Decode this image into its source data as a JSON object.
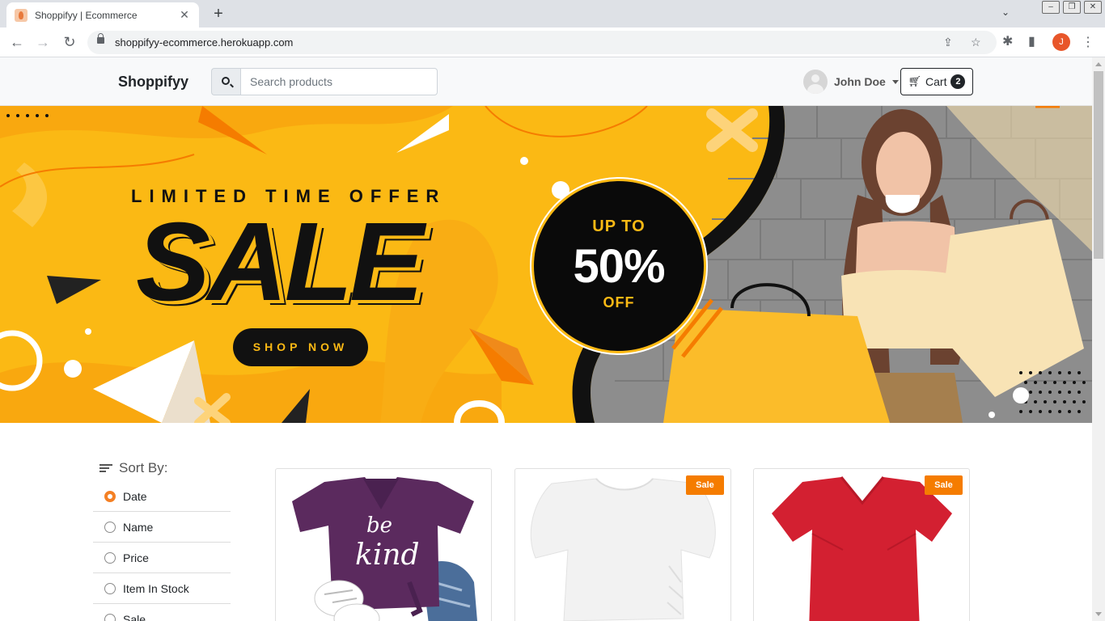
{
  "browser": {
    "tab_title": "Shoppifyy | Ecommerce",
    "url": "shoppifyy-ecommerce.herokuapp.com",
    "profile_initial": "J"
  },
  "header": {
    "brand": "Shoppifyy",
    "search_placeholder": "Search products",
    "user_name": "John Doe",
    "cart_label": "Cart",
    "cart_count": "2"
  },
  "hero": {
    "tagline": "LIMITED TIME OFFER",
    "headline": "SALE",
    "cta": "SHOP NOW",
    "badge_top": "UP TO",
    "badge_value": "50%",
    "badge_bottom": "OFF",
    "colors": {
      "yellow": "#fbb914",
      "orange": "#f57c00",
      "black": "#111111"
    }
  },
  "sort": {
    "title": "Sort By:",
    "options": [
      {
        "label": "Date",
        "selected": true
      },
      {
        "label": "Name",
        "selected": false
      },
      {
        "label": "Price",
        "selected": false
      },
      {
        "label": "Item In Stock",
        "selected": false
      },
      {
        "label": "Sale",
        "selected": false
      }
    ]
  },
  "products": [
    {
      "image": "purple-be-kind-tshirt",
      "badge": "",
      "color": "#5b2a5e"
    },
    {
      "image": "white-tshirt",
      "badge": "Sale",
      "color": "#f4f4f4"
    },
    {
      "image": "red-tshirt",
      "badge": "Sale",
      "color": "#d32031"
    }
  ]
}
